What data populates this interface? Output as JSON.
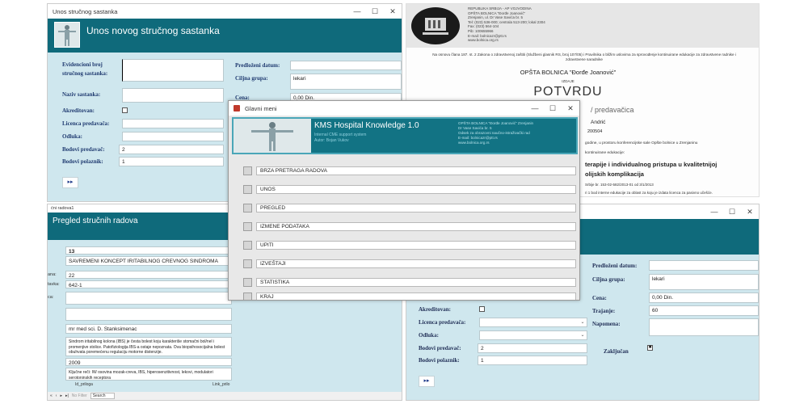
{
  "win_unos": {
    "title": "Unos stručnog sastanka",
    "header": "Unos novog stručnog sastanka",
    "labels": {
      "evidencioni": "Evidencioni broj stručnog sastanka:",
      "naziv": "Naziv sastanka:",
      "akreditovan": "Akreditovan:",
      "licenca": "Licenca predavača:",
      "odluka": "Odluka:",
      "bodovi_predavac": "Bodovi predavač:",
      "bodovi_polaznik": "Bodovi polaznik:",
      "predlozeni_datum": "Predloženi datum:",
      "ciljna_grupa": "Ciljna grupa:",
      "cena": "Cena:"
    },
    "values": {
      "bodovi_predavac": "2",
      "bodovi_polaznik": "1",
      "ciljna_grupa": "lekari",
      "cena": "0,00 Din."
    },
    "nav_label": "▸▸"
  },
  "doc": {
    "inst_lines": [
      "REPUBLIKA SRBIJA - AP VOJVODINA",
      "OPŠTA BOLNICA \"Đorđe Joanović\"",
      "Zrenjanin, ul. Dr Vase Savića br. 5",
      "Tel: (023) 536-000; centrala 513-200; lokal 2304",
      "Fax: (023) 564-104",
      "Pib: 100655966",
      "E-mail: bolnicazr@ptt.rs",
      "www.bolnica.org.rs"
    ],
    "legal": "Na osnovu člana 187. st. 2 Zakona o zdravstvenoj zaštiti (Službeni glasnik RS, broj 107/05) i Pravilnika o bližim uslovima za sprovođenje kontinuirane edukacije za zdravstvene radnike i zdravstvene saradnike",
    "org": "OPŠTA BOLNICA \"Đorđe Joanović\"",
    "izdaje": "IZDAJE",
    "potvrdu": "POTVRDU",
    "predavaca": "/ predavačica",
    "name": "Andrić",
    "number": "200504",
    "line1": "godine, u prostoru konferencijske sale Opšte bolnice u Zrenjaninu",
    "line2": "kontinuirane edukacije:",
    "topic1": "terapije i individualnog pristupa u kvalitetnijoj",
    "topic2": "olijskih komplikacija",
    "line3": "Srbije br. 153-02-582/2013-01 od 3/1/2013",
    "line4": "ri 1 bod interne edukacije za oblast za koju je izdata licenca za pasivno učešće."
  },
  "menu_win": {
    "title": "Glavni meni",
    "app_name": "KMS Hospital Knowledge 1.0",
    "subtitle": "Internal CME support system",
    "author": "Autor: Bojan Vukov",
    "info_lines": [
      "OPŠTA BOLNICA \"Đorđe Joanović\" Zrenjanin",
      "Dr Vase Savića br. 5",
      "Odsek za obrazovni naučno-istraživački rad",
      "E-mail: bolnicazr@ptt.rs",
      "www.bolnica.org.rs"
    ],
    "items": [
      "BRZA PRETRAGA RADOVA",
      "UNOS",
      "PREGLED",
      "IZMENE PODATAKA",
      "UPITI",
      "IZVEŠTAJI",
      "STATISTIKA",
      "KRAJ"
    ]
  },
  "pregled": {
    "tab": "ćni radova1",
    "header": "Pregled stručnih radova",
    "id_value": "13",
    "title_value": "SAVREMENI KONCEPT IRITABILNOG CREVNOG SINDROMA",
    "label_a": "ana:",
    "value_a": "22",
    "label_b": "tavka:",
    "value_b": "642-1",
    "label_c": "ca:",
    "author": "mr med sci. D. Stanksimenac",
    "abstract": "Sindrom iritabilnog kolona (IBS) je česta bolest koju karakteriše stomačni bol/nel i promenjive stolice. Patofiziologija IBS-a ostaje nepoznata. Ova biopsihosocijalna bolest obuhvata poremećenu regulaciju motorne distenzije.",
    "year": "2009",
    "keywords": "Ključne reči: IW osovina mozak-creva, IBS, hiperosenzitivnost, lekovi, modulatori serotoninskih receptora",
    "attach": "Id_priloga",
    "link": "Link_prilo",
    "status": [
      "«",
      "‹",
      "▸",
      "▸|",
      "No Filter",
      "Search"
    ]
  },
  "win_unos2": {
    "labels": {
      "predlozeni_datum": "Predloženi datum:",
      "ciljna_grupa": "Ciljna grupa:",
      "cena": "Cena:",
      "trajanje": "Trajanje:",
      "napomena": "Napomena:",
      "akreditovan": "Akreditovan:",
      "licenca": "Licenca predavača:",
      "odluka": "Odluka:",
      "bodovi_predavac": "Bodovi predavač:",
      "bodovi_polaznik": "Bodovi polaznik:",
      "zakljucan": "Zaključan"
    },
    "values": {
      "ciljna_grupa": "lekari",
      "cena": "0,00 Din.",
      "trajanje": "60",
      "bodovi_predavac": "2",
      "bodovi_polaznik": "1"
    },
    "nav_label": "▸▸"
  },
  "controls": {
    "minimize": "—",
    "maximize": "☐",
    "close": "✕"
  }
}
